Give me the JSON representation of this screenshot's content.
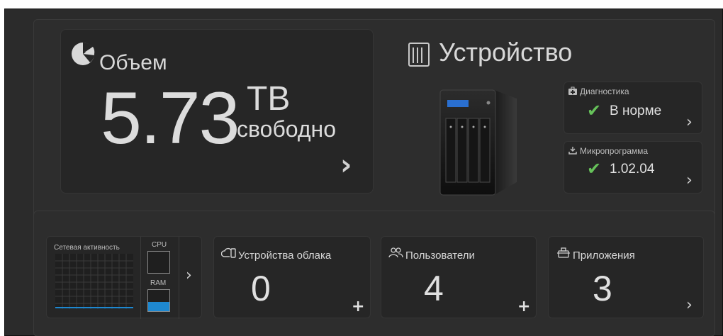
{
  "volume": {
    "title": "Объем",
    "value": "5.73",
    "unit": "TB",
    "free_label": "свободно",
    "icon": "pie-chart-icon"
  },
  "device": {
    "title": "Устройство",
    "icon": "server-icon",
    "image": "nas-device-image"
  },
  "diagnostics": {
    "label": "Диагностика",
    "status": "В норме",
    "icon": "medkit-icon",
    "status_icon": "checkmark-icon",
    "status_color": "#66c25a"
  },
  "firmware": {
    "label": "Микропрограмма",
    "version": "1.02.04",
    "icon": "download-icon",
    "status_icon": "checkmark-icon"
  },
  "network": {
    "label": "Сетевая активность",
    "cpu_label": "CPU",
    "ram_label": "RAM",
    "ram_fill_color": "#1e88d0"
  },
  "cloud_devices": {
    "title": "Устройства облака",
    "count": "0",
    "icon": "cloud-device-icon"
  },
  "users": {
    "title": "Пользователи",
    "count": "4",
    "icon": "users-icon"
  },
  "apps": {
    "title": "Приложения",
    "count": "3",
    "icon": "apps-icon"
  }
}
